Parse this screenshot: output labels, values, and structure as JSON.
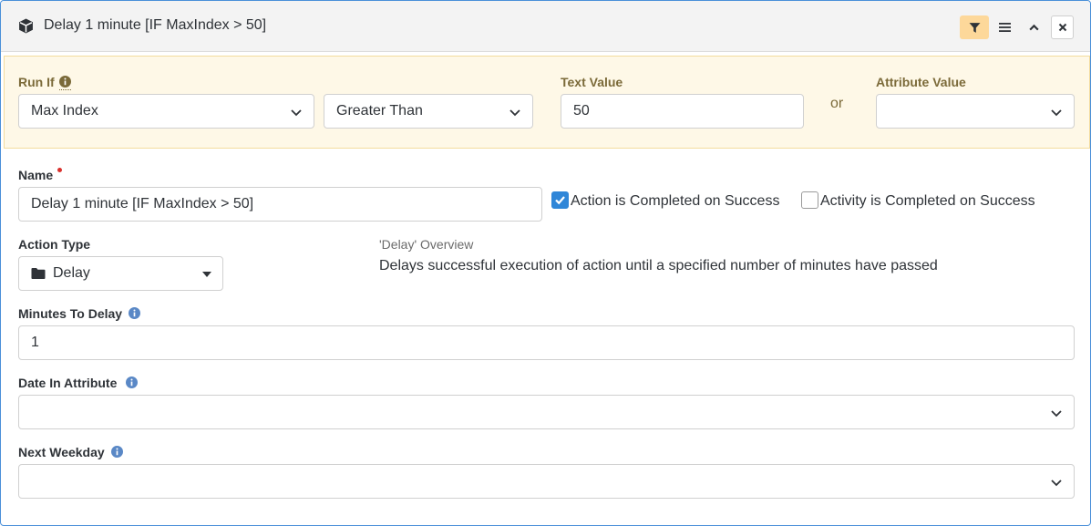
{
  "header": {
    "title": "Delay 1 minute [IF MaxIndex > 50]",
    "icon": "cube-icon",
    "buttons": [
      "filter-icon",
      "list-icon",
      "chevron-up-icon",
      "close-icon"
    ],
    "filter_active_color": "#fdd89a"
  },
  "run_if": {
    "label": "Run If",
    "attribute": "Max Index",
    "comparison": "Greater Than",
    "text_value_label": "Text Value",
    "text_value": "50",
    "or_label": "or",
    "attribute_value_label": "Attribute Value",
    "attribute_value": "",
    "background_color": "#fef8e7"
  },
  "name": {
    "label": "Name",
    "value": "Delay 1 minute [IF MaxIndex > 50]",
    "required": true
  },
  "checkboxes": [
    {
      "label": "Action is Completed on Success",
      "checked": true
    },
    {
      "label": "Activity is Completed on Success",
      "checked": false
    }
  ],
  "action_type": {
    "label": "Action Type",
    "value": "Delay",
    "icon": "folder-icon"
  },
  "overview": {
    "title": "'Delay' Overview",
    "description": "Delays successful execution of action until a specified number of minutes have passed"
  },
  "minutes_to_delay": {
    "label": "Minutes To Delay",
    "value": "1"
  },
  "date_in_attribute": {
    "label": "Date In Attribute",
    "value": ""
  },
  "next_weekday": {
    "label": "Next Weekday",
    "value": ""
  },
  "colors": {
    "accent": "#2f86d8",
    "border": "#4a90d9"
  }
}
